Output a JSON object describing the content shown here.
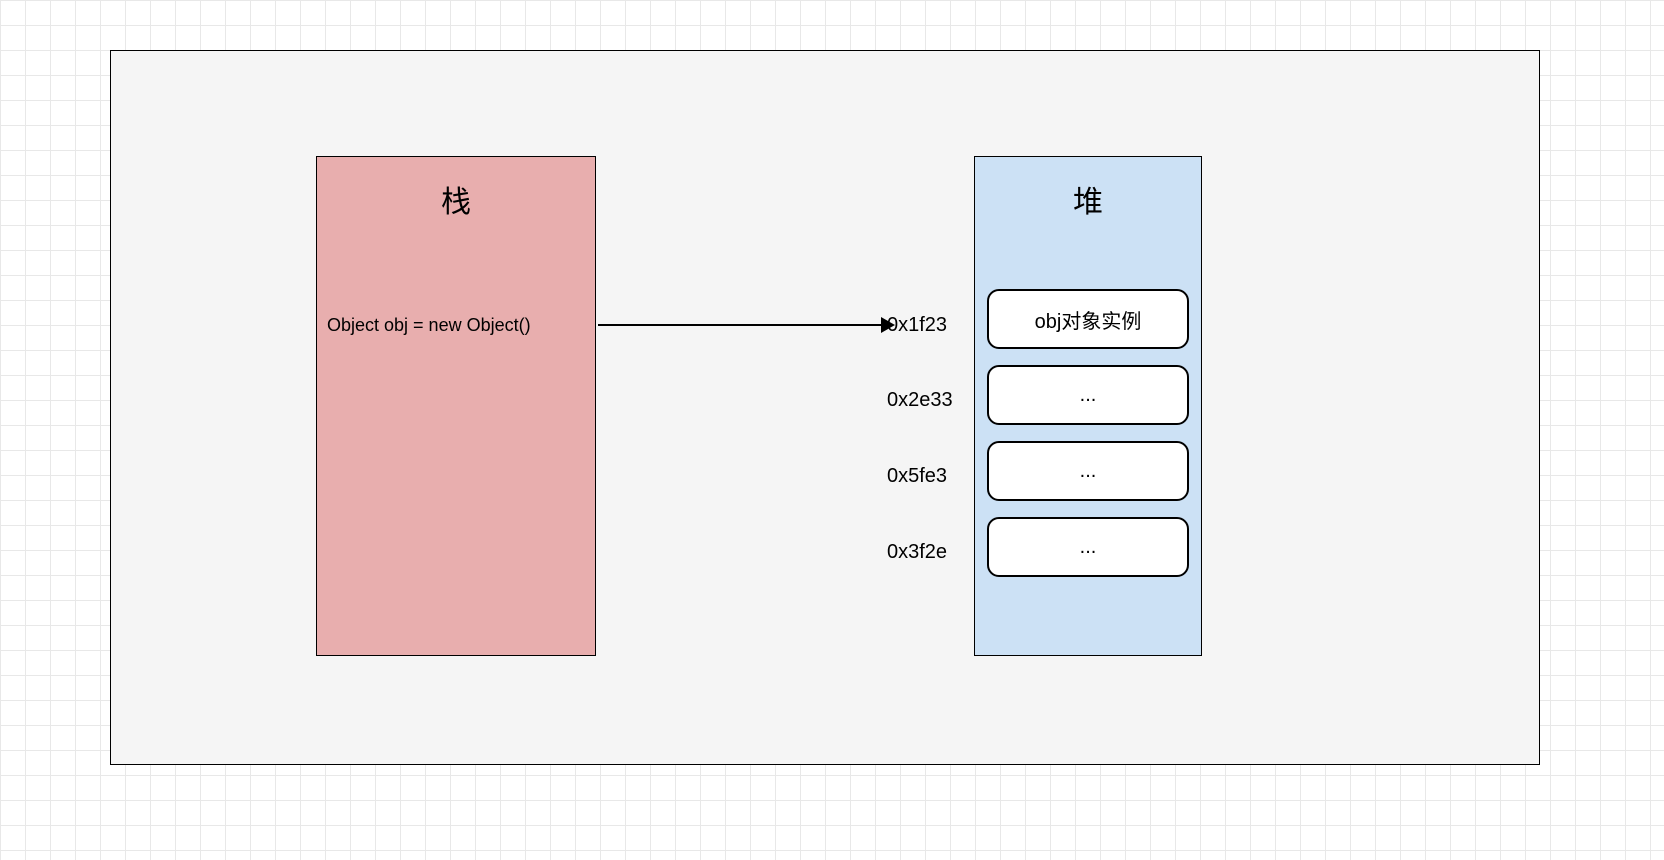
{
  "canvas": {
    "stack": {
      "title": "栈",
      "code": "Object obj = new Object()"
    },
    "heap": {
      "title": "堆",
      "items": [
        {
          "address": "0x1f23",
          "label": "obj对象实例"
        },
        {
          "address": "0x2e33",
          "label": "..."
        },
        {
          "address": "0x5fe3",
          "label": "..."
        },
        {
          "address": "0x3f2e",
          "label": "..."
        }
      ]
    }
  }
}
